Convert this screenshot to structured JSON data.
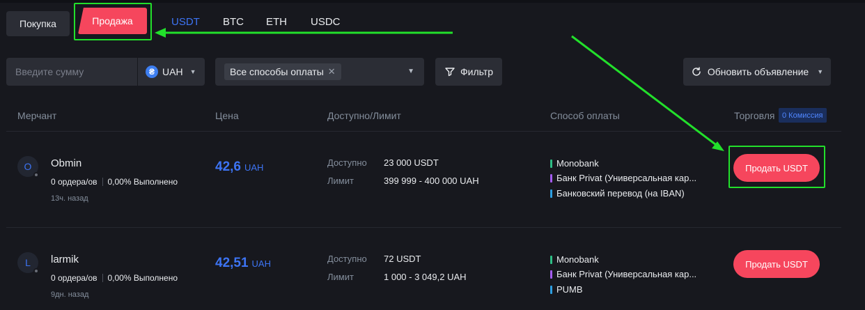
{
  "side_tabs": {
    "buy": "Покупка",
    "sell": "Продажа"
  },
  "coin_tabs": [
    "USDT",
    "BTC",
    "ETH",
    "USDC"
  ],
  "filters": {
    "amount_placeholder": "Введите сумму",
    "currency": "UAH",
    "payment_method": "Все способы оплаты",
    "filter_label": "Фильтр",
    "refresh_label": "Обновить объявление"
  },
  "table_header": {
    "merchant": "Мерчант",
    "price": "Цена",
    "available_limit": "Доступно/Лимит",
    "payment_method": "Способ оплаты",
    "trade": "Торговля",
    "commission_badge": "0 Комиссия"
  },
  "labels": {
    "available": "Доступно",
    "limit": "Лимит"
  },
  "rows": [
    {
      "avatar": "O",
      "name": "Obmin",
      "orders": "0 ордера/ов",
      "completion": "0,00% Выполнено",
      "time": "13ч. назад",
      "price": "42,6",
      "currency": "UAH",
      "available": "23 000 USDT",
      "limit": "399 999 - 400 000 UAH",
      "methods": [
        {
          "name": "Monobank",
          "color": "#2ebd85"
        },
        {
          "name": "Банк Privat (Универсальная кар...",
          "color": "#a45cf2"
        },
        {
          "name": "Банковский перевод (на IBAN)",
          "color": "#2d9ee0"
        }
      ],
      "action": "Продать USDT"
    },
    {
      "avatar": "L",
      "name": "larmik",
      "orders": "0 ордера/ов",
      "completion": "0,00% Выполнено",
      "time": "9дн. назад",
      "price": "42,51",
      "currency": "UAH",
      "available": "72 USDT",
      "limit": "1 000 - 3 049,2 UAH",
      "methods": [
        {
          "name": "Monobank",
          "color": "#2ebd85"
        },
        {
          "name": "Банк Privat (Универсальная кар...",
          "color": "#a45cf2"
        },
        {
          "name": "PUMB",
          "color": "#2d9ee0"
        }
      ],
      "action": "Продать USDT"
    }
  ],
  "colors": {
    "accent_blue": "#3d74f4",
    "sell_red": "#f6465d",
    "annotation_green": "#22e02b"
  }
}
